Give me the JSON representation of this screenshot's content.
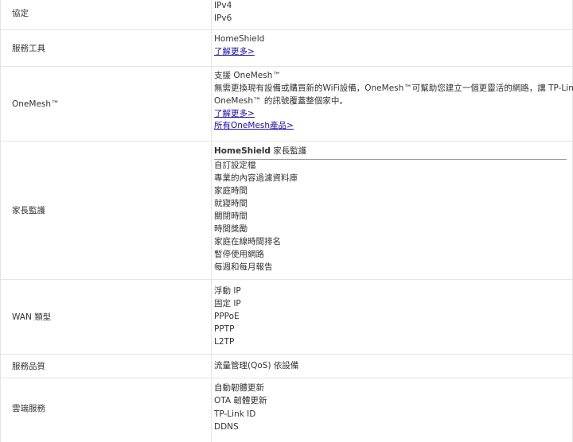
{
  "rows": {
    "protocol": {
      "label": "協定",
      "values": [
        "IPv4",
        "IPv6"
      ]
    },
    "service_tools": {
      "label": "服務工具",
      "value": "HomeShield",
      "link": "了解更多>"
    },
    "onemesh": {
      "label": "OneMesh™",
      "line1": "支援 OneMesh™",
      "desc_line1": "無需更換現有設備或購買新的WiFi設備，OneMesh™可幫助您建立一個更靈活的網路，讓 TP-Link",
      "desc_line2": "OneMesh™ 的訊號覆蓋整個家中。",
      "link1": "了解更多>",
      "link2": "所有OneMesh產品>"
    },
    "parental": {
      "label": "家長監護",
      "subhead_bold": "HomeShield",
      "subhead_normal": " 家長監護",
      "items": [
        "自訂設定檔",
        "專業的內容過濾資料庫",
        "家庭時間",
        "就寢時間",
        "關閉時間",
        "時間獎勵",
        "家庭在線時間排名",
        "暫停使用網路",
        "每週和每月報告"
      ]
    },
    "wan": {
      "label": "WAN 類型",
      "items": [
        "浮動 IP",
        "固定 IP",
        "PPPoE",
        "PPTP",
        "L2TP"
      ]
    },
    "qos": {
      "label": "服務品質",
      "value": "流量管理(QoS) 依設備"
    },
    "cloud": {
      "label": "雲端服務",
      "items": [
        "自動韌體更新",
        "OTA 韌體更新",
        "TP-Link ID",
        "DDNS"
      ]
    }
  }
}
